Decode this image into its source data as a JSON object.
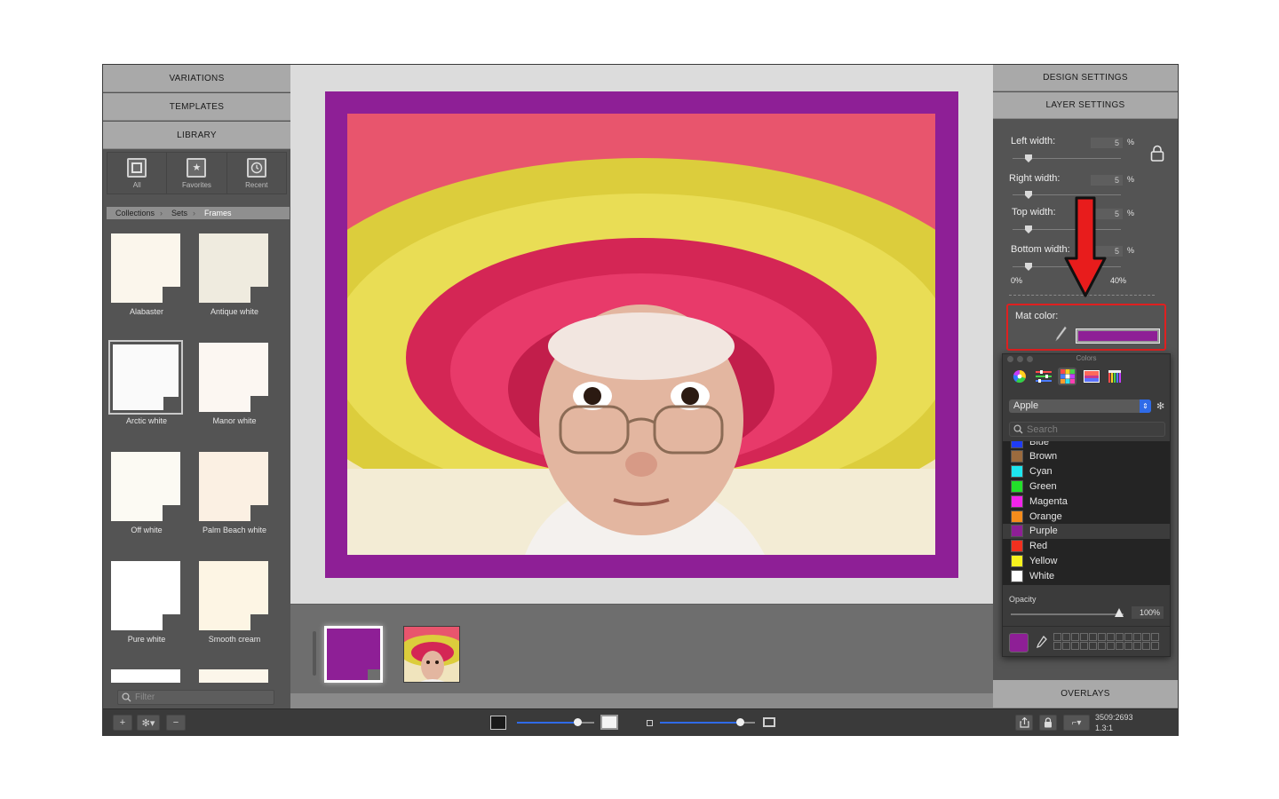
{
  "left_panel": {
    "accordion": [
      "VARIATIONS",
      "TEMPLATES",
      "LIBRARY"
    ],
    "library_tabs": [
      {
        "label": "All",
        "icon": "square-frame-icon"
      },
      {
        "label": "Favorites",
        "icon": "star-icon"
      },
      {
        "label": "Recent",
        "icon": "clock-icon"
      }
    ],
    "breadcrumb": [
      "Collections",
      "Sets",
      "Frames"
    ],
    "frames": [
      {
        "name": "Alabaster",
        "color": "#fbf6ec"
      },
      {
        "name": "Antique white",
        "color": "#efebdf"
      },
      {
        "name": "Arctic white",
        "color": "#fafafa"
      },
      {
        "name": "Manor white",
        "color": "#fcf7f2"
      },
      {
        "name": "Off white",
        "color": "#fcfaf3"
      },
      {
        "name": "Palm Beach white",
        "color": "#fbf0e3"
      },
      {
        "name": "Pure white",
        "color": "#ffffff"
      },
      {
        "name": "Smooth cream",
        "color": "#fdf5e4"
      }
    ],
    "selected_frame": "Arctic white",
    "filter_placeholder": "Filter"
  },
  "canvas": {
    "mat_color": "#8e1f96"
  },
  "right_panel": {
    "headers": {
      "design": "DESIGN SETTINGS",
      "layer": "LAYER SETTINGS",
      "overlays": "OVERLAYS"
    },
    "sliders": [
      {
        "label": "Left width:",
        "value": "5",
        "unit": "%"
      },
      {
        "label": "Right width:",
        "value": "5",
        "unit": "%"
      },
      {
        "label": "Top width:",
        "value": "5",
        "unit": "%"
      },
      {
        "label": "Bottom width:",
        "value": "5",
        "unit": "%"
      }
    ],
    "range_min": "0%",
    "range_max": "40%",
    "mat_color_label": "Mat color:"
  },
  "colors_window": {
    "title": "Colors",
    "palette": "Apple",
    "search_placeholder": "Search",
    "items": [
      {
        "name": "Blue",
        "color": "#1f3cf5"
      },
      {
        "name": "Brown",
        "color": "#9b6b3e"
      },
      {
        "name": "Cyan",
        "color": "#1ee6ef"
      },
      {
        "name": "Green",
        "color": "#22e02a"
      },
      {
        "name": "Magenta",
        "color": "#f224ea"
      },
      {
        "name": "Orange",
        "color": "#f58c1c"
      },
      {
        "name": "Purple",
        "color": "#8e1f96"
      },
      {
        "name": "Red",
        "color": "#f2301f"
      },
      {
        "name": "Yellow",
        "color": "#f7f21e"
      },
      {
        "name": "White",
        "color": "#ffffff"
      }
    ],
    "selected": "Purple",
    "opacity_label": "Opacity",
    "opacity_value": "100%",
    "opacity_fraction": 1.0
  },
  "bottom_bar": {
    "dimensions": "3509:2693",
    "ratio": "1.3:1"
  },
  "annotation": {
    "arrow_color": "#e81c1c"
  }
}
